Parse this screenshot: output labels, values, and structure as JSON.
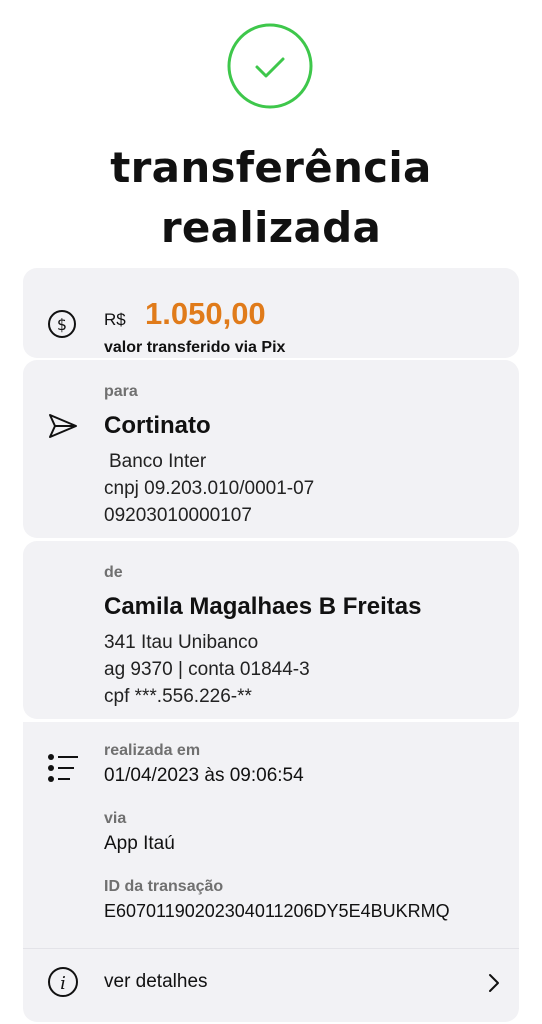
{
  "status": {
    "icon": "check-circle-icon",
    "title_line1": "transferência",
    "title_line2": "realizada",
    "accent": "#3ec74b"
  },
  "amount": {
    "icon": "dollar-circle-icon",
    "currency": "R$",
    "value": "1.050,00",
    "value_color": "#e07b1a",
    "caption": "valor transferido via Pix"
  },
  "recipient": {
    "icon": "send-arrow-icon",
    "label": "para",
    "name": "Cortinato",
    "bank": "Banco Inter",
    "document": "cnpj 09.203.010/0001-07",
    "key": "09203010000107"
  },
  "sender": {
    "label": "de",
    "name": "Camila Magalhaes B Freitas",
    "bank": "341 Itau Unibanco",
    "account": "ag 9370 | conta 01844-3",
    "document": "cpf ***.556.226-**"
  },
  "info": {
    "icon": "list-icon",
    "date_label": "realizada em",
    "date_value": "01/04/2023 às 09:06:54",
    "via_label": "via",
    "via_value": "App Itaú",
    "id_label": "ID da transação",
    "id_value": "E60701190202304011206DY5E4BUKRMQ"
  },
  "details": {
    "icon": "info-icon",
    "label": "ver detalhes",
    "chevron": "chevron-right-icon"
  }
}
